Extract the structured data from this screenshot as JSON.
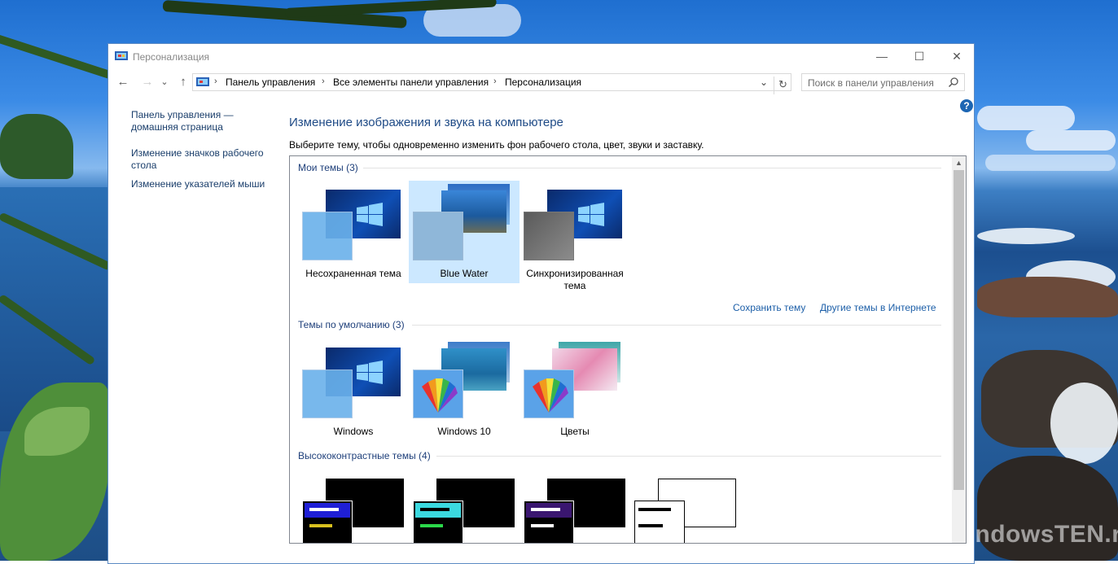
{
  "window": {
    "title": "Персонализация",
    "min_label": "—",
    "max_label": "☐",
    "close_label": "✕"
  },
  "nav": {
    "back": "←",
    "forward": "→",
    "recent": "⌄",
    "up": "↑"
  },
  "address": {
    "crumbs": [
      "Панель управления",
      "Все элементы панели управления",
      "Персонализация"
    ],
    "sep": "›",
    "dropdown": "⌄",
    "refresh": "↻"
  },
  "search": {
    "placeholder": "Поиск в панели управления"
  },
  "help_label": "?",
  "sidebar": {
    "items": [
      {
        "label": "Панель управления — домашняя страница"
      },
      {
        "label": "Изменение значков рабочего стола"
      },
      {
        "label": "Изменение указателей мыши"
      }
    ]
  },
  "main": {
    "heading": "Изменение изображения и звука на компьютере",
    "description": "Выберите тему, чтобы одновременно изменить фон рабочего стола, цвет, звуки и заставку."
  },
  "groups": {
    "my": {
      "title": "Мои темы (3)",
      "themes": [
        {
          "label": "Несохраненная тема",
          "selected": false
        },
        {
          "label": "Blue Water",
          "selected": true
        },
        {
          "label": "Синхронизированная тема",
          "selected": false
        }
      ],
      "save_link": "Сохранить тему",
      "more_link": "Другие темы в Интернете"
    },
    "default": {
      "title": "Темы по умолчанию (3)",
      "themes": [
        {
          "label": "Windows"
        },
        {
          "label": "Windows 10"
        },
        {
          "label": "Цветы"
        }
      ]
    },
    "hc": {
      "title": "Высококонтрастные темы (4)",
      "accents": [
        "#1f1fd6",
        "#3bd9e0",
        "#3a1670",
        "#ffffff"
      ]
    }
  },
  "watermark": "WindowsTEN.ru",
  "colors": {
    "heading": "#1e4a86",
    "link": "#1d5fa8",
    "selection": "#cce8ff"
  }
}
